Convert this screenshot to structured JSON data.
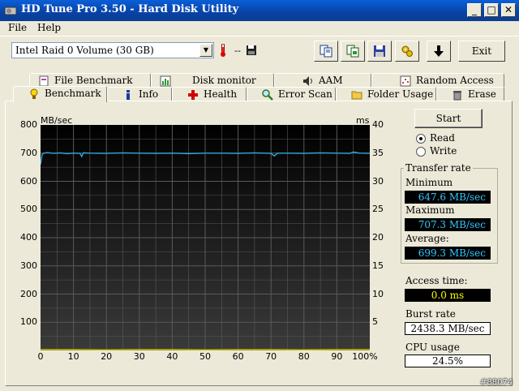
{
  "window": {
    "title": "HD Tune Pro 3.50 - Hard Disk Utility",
    "min": "_",
    "max": "□",
    "close": "✕"
  },
  "menu": [
    {
      "label": "File"
    },
    {
      "label": "Help"
    }
  ],
  "toolbar": {
    "drive": "Intel   Raid 0 Volume (30 GB)",
    "temperature": "-- ",
    "exit_label": "Exit"
  },
  "tabs_top": [
    {
      "label": "File Benchmark",
      "icon": "file-benchmark-icon"
    },
    {
      "label": "Disk monitor",
      "icon": "disk-monitor-icon"
    },
    {
      "label": "AAM",
      "icon": "speaker-icon"
    },
    {
      "label": "Random Access",
      "icon": "random-access-icon"
    }
  ],
  "tabs_bottom": [
    {
      "label": "Benchmark",
      "icon": "benchmark-icon",
      "active": true
    },
    {
      "label": "Info",
      "icon": "info-icon"
    },
    {
      "label": "Health",
      "icon": "health-cross-icon"
    },
    {
      "label": "Error Scan",
      "icon": "magnifier-icon"
    },
    {
      "label": "Folder Usage",
      "icon": "folder-icon"
    },
    {
      "label": "Erase",
      "icon": "trash-icon"
    }
  ],
  "chart_data": {
    "type": "line",
    "ylabel": "MB/sec",
    "y2label": "ms",
    "ylim": [
      0,
      800
    ],
    "y2lim": [
      0,
      40
    ],
    "xlim": [
      0,
      100
    ],
    "x_unit": "%",
    "y_ticks": [
      "800",
      "700",
      "600",
      "500",
      "400",
      "300",
      "200",
      "100"
    ],
    "y2_ticks": [
      "40",
      "35",
      "30",
      "25",
      "20",
      "15",
      "10",
      "5"
    ],
    "x_ticks": [
      "0",
      "10",
      "20",
      "30",
      "40",
      "50",
      "60",
      "70",
      "80",
      "90",
      "100%"
    ],
    "grid": true,
    "series": [
      {
        "color": "#2aa8d8",
        "x": [
          0,
          0.5,
          1,
          2,
          4,
          6,
          8,
          10,
          12,
          12.5,
          13,
          15,
          20,
          25,
          30,
          35,
          40,
          45,
          50,
          55,
          60,
          65,
          70,
          71,
          72,
          75,
          80,
          85,
          90,
          94,
          95,
          97,
          100
        ],
        "y": [
          660,
          695,
          700,
          702,
          699,
          701,
          698,
          700,
          699,
          688,
          701,
          700,
          699,
          701,
          700,
          699,
          700,
          698,
          700,
          700,
          699,
          701,
          699,
          690,
          700,
          700,
          699,
          701,
          700,
          699,
          704,
          700,
          699
        ]
      },
      {
        "color": "#c8c800",
        "x": [
          0,
          10,
          20,
          30,
          40,
          50,
          60,
          70,
          80,
          90,
          100
        ],
        "y": [
          3,
          3,
          2,
          3,
          3,
          2,
          3,
          3,
          2,
          3,
          3
        ]
      }
    ]
  },
  "controls": {
    "start_label": "Start",
    "read_label": "Read",
    "write_label": "Write",
    "read_checked": true
  },
  "transfer": {
    "group_title": "Transfer rate",
    "min_label": "Minimum",
    "min_value": "647.6 MB/sec",
    "max_label": "Maximum",
    "max_value": "707.3 MB/sec",
    "avg_label": "Average:",
    "avg_value": "699.3 MB/sec"
  },
  "stats": {
    "access_label": "Access time:",
    "access_value": "0.0 ms",
    "burst_label": "Burst rate",
    "burst_value": "2438.3 MB/sec",
    "cpu_label": "CPU usage",
    "cpu_value": "24.5%"
  },
  "watermark": "#88074"
}
